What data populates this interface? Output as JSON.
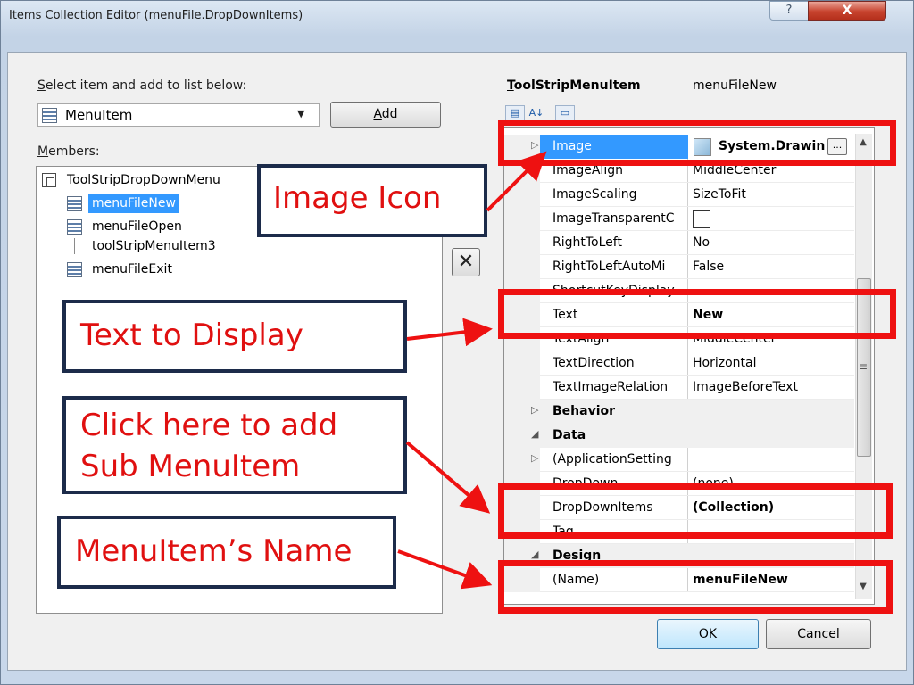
{
  "window": {
    "title": "Items Collection Editor (menuFile.DropDownItems)",
    "help_glyph": "?",
    "close_glyph": "X"
  },
  "left": {
    "select_label_u": "S",
    "select_label_rest": "elect item and add to list below:",
    "type_combo_value": "MenuItem",
    "add_button_u": "A",
    "add_button_rest": "dd",
    "members_label_u": "M",
    "members_label_rest": "embers:",
    "tree": {
      "root": "ToolStripDropDownMenu",
      "items": [
        {
          "label": "menuFileNew",
          "selected": true,
          "icon": "menu-item-icon"
        },
        {
          "label": "menuFileOpen",
          "selected": false,
          "icon": "menu-item-icon"
        },
        {
          "label": "toolStripMenuItem3",
          "selected": false,
          "icon": "separator-icon"
        },
        {
          "label": "menuFileExit",
          "selected": false,
          "icon": "menu-item-icon"
        }
      ]
    },
    "delete_glyph": "✕"
  },
  "right": {
    "header_type_u": "T",
    "header_type_rest": "oolStripMenuItem",
    "header_name": "menuFileNew",
    "properties": [
      {
        "name": "Image",
        "value": "System.Drawin",
        "selected": true,
        "has_button": true
      },
      {
        "name": "ImageAlign",
        "value": "MiddleCenter"
      },
      {
        "name": "ImageScaling",
        "value": "SizeToFit"
      },
      {
        "name": "ImageTransparentC",
        "value": ""
      },
      {
        "name": "RightToLeft",
        "value": "No"
      },
      {
        "name": "RightToLeftAutoMi",
        "value": "False"
      },
      {
        "name": "ShortcutKeyDisplay",
        "value": ""
      },
      {
        "name": "Text",
        "value": "New",
        "bold": true
      },
      {
        "name": "TextAlign",
        "value": "MiddleCenter"
      },
      {
        "name": "TextDirection",
        "value": "Horizontal"
      },
      {
        "name": "TextImageRelation",
        "value": "ImageBeforeText"
      },
      {
        "name": "Behavior",
        "category": true,
        "expanded": false
      },
      {
        "name": "Data",
        "category": true,
        "expanded": true
      },
      {
        "name": "(ApplicationSetting",
        "value": "",
        "expandable": true
      },
      {
        "name": "DropDown",
        "value": "(none)"
      },
      {
        "name": "DropDownItems",
        "value": "(Collection)",
        "bold": true
      },
      {
        "name": "Tag",
        "value": ""
      },
      {
        "name": "Design",
        "category": true,
        "expanded": true
      },
      {
        "name": "(Name)",
        "value": "menuFileNew",
        "bold": true
      }
    ],
    "ellipsis": "..."
  },
  "buttons": {
    "ok": "OK",
    "cancel": "Cancel"
  },
  "annotations": {
    "image_icon": "Image Icon",
    "text_to_display": "Text to Display",
    "add_sub_line1": "Click here to add",
    "add_sub_line2": "Sub MenuItem",
    "item_name": "MenuItem’s Name"
  },
  "colors": {
    "annotation_red": "#ee1111",
    "callout_border": "#1c2b4a",
    "selection": "#3399ff"
  }
}
